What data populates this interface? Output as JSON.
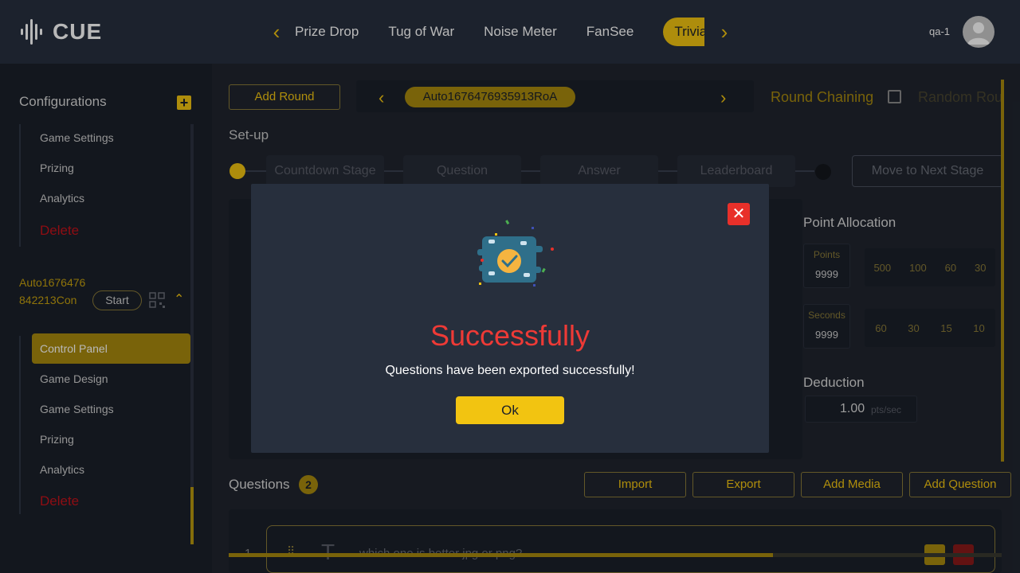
{
  "header": {
    "logo_text": "CUE",
    "tabs": [
      {
        "label": "Prize Drop"
      },
      {
        "label": "Tug of War"
      },
      {
        "label": "Noise Meter"
      },
      {
        "label": "FanSee"
      },
      {
        "label": "Trivia",
        "active": true
      }
    ],
    "user_name": "qa-1"
  },
  "sidebar": {
    "title": "Configurations",
    "group1": [
      "Game Settings",
      "Prizing",
      "Analytics"
    ],
    "group1_delete": "Delete",
    "config_name": "Auto1676476842213Con",
    "start_label": "Start",
    "group2_active": "Control Panel",
    "group2": [
      "Game Design",
      "Game Settings",
      "Prizing",
      "Analytics"
    ],
    "group2_delete": "Delete"
  },
  "main": {
    "add_round": "Add Round",
    "round_name": "Auto1676476935913RoA",
    "round_chaining": "Round Chaining",
    "random_round": "Random Rou",
    "setup": "Set-up",
    "stages": [
      "Countdown Stage",
      "Question",
      "Answer",
      "Leaderboard"
    ],
    "move_next": "Move to Next Stage",
    "point_allocation": "Point Allocation",
    "points_label": "Points",
    "points_value": "9999",
    "points_options": [
      "500",
      "100",
      "60",
      "30"
    ],
    "seconds_label": "Seconds",
    "seconds_value": "9999",
    "seconds_options": [
      "60",
      "30",
      "15",
      "10"
    ],
    "deduction": "Deduction",
    "deduction_value": "1.00",
    "deduction_unit": "pts/sec",
    "questions_title": "Questions",
    "questions_count": "2",
    "import": "Import",
    "export": "Export",
    "add_media": "Add Media",
    "add_question": "Add Question",
    "question_num": "1",
    "question_text": "which one is better jpg or png?"
  },
  "modal": {
    "title": "Successfully",
    "message": "Questions have been exported successfully!",
    "ok": "Ok"
  }
}
